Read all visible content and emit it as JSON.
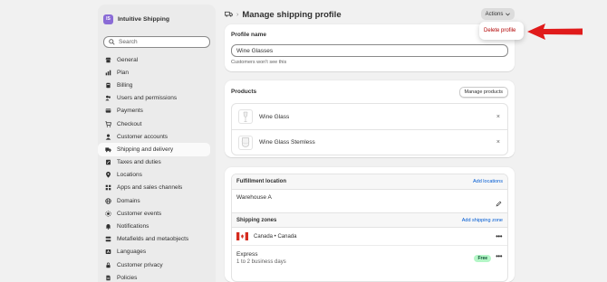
{
  "store": {
    "avatar_initials": "IS",
    "name": "Intuitive Shipping",
    "avatar_color": "#8a6bd6"
  },
  "search": {
    "placeholder": "Search"
  },
  "nav": [
    {
      "label": "General",
      "icon": "store-icon"
    },
    {
      "label": "Plan",
      "icon": "chart-icon"
    },
    {
      "label": "Billing",
      "icon": "billing-icon"
    },
    {
      "label": "Users and permissions",
      "icon": "users-icon"
    },
    {
      "label": "Payments",
      "icon": "payments-icon"
    },
    {
      "label": "Checkout",
      "icon": "cart-icon"
    },
    {
      "label": "Customer accounts",
      "icon": "person-icon"
    },
    {
      "label": "Shipping and delivery",
      "icon": "truck-icon",
      "active": true
    },
    {
      "label": "Taxes and duties",
      "icon": "tax-icon"
    },
    {
      "label": "Locations",
      "icon": "location-icon"
    },
    {
      "label": "Apps and sales channels",
      "icon": "apps-icon"
    },
    {
      "label": "Domains",
      "icon": "globe-icon"
    },
    {
      "label": "Customer events",
      "icon": "events-icon"
    },
    {
      "label": "Notifications",
      "icon": "bell-icon"
    },
    {
      "label": "Metafields and metaobjects",
      "icon": "metafields-icon"
    },
    {
      "label": "Languages",
      "icon": "language-icon"
    },
    {
      "label": "Customer privacy",
      "icon": "lock-icon"
    },
    {
      "label": "Policies",
      "icon": "policy-icon"
    }
  ],
  "header": {
    "breadcrumb_sep": "›",
    "title": "Manage shipping profile",
    "actions_label": "Actions"
  },
  "popover": {
    "delete_label": "Delete profile"
  },
  "profile": {
    "title": "Profile name",
    "value": "Wine Glasses",
    "help": "Customers won't see this"
  },
  "products": {
    "title": "Products",
    "manage_label": "Manage products",
    "items": [
      {
        "name": "Wine Glass"
      },
      {
        "name": "Wine Glass Stemless"
      }
    ],
    "remove_glyph": "×"
  },
  "fulfillment": {
    "location_label": "Fulfillment location",
    "add_locations": "Add locations",
    "warehouse": "Warehouse A",
    "zones_label": "Shipping zones",
    "add_zone": "Add shipping zone",
    "zone_name": "Canada • Canada",
    "rate_name": "Express",
    "rate_time": "1 to 2 business days",
    "rate_badge": "Free",
    "menu_glyph": "•••"
  },
  "colors": {
    "link": "#005bd3",
    "danger": "#b10000",
    "arrow": "#e01b1b",
    "badge_bg": "#b4f6c7"
  }
}
